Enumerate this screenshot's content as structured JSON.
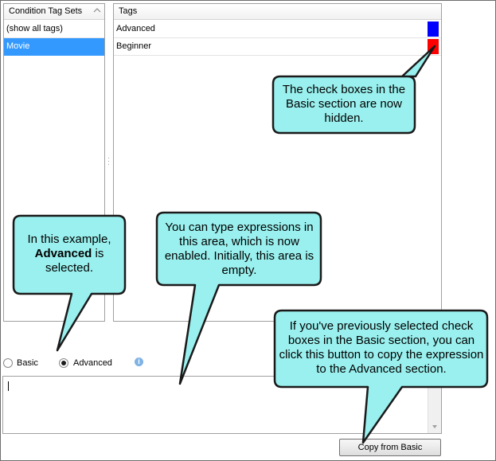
{
  "tag_sets_panel": {
    "header": "Condition Tag Sets",
    "items": [
      {
        "label": "(show all tags)",
        "selected": false
      },
      {
        "label": "Movie",
        "selected": true
      }
    ]
  },
  "tags_panel": {
    "header": "Tags",
    "items": [
      {
        "label": "Advanced",
        "color": "#0000ff"
      },
      {
        "label": "Beginner",
        "color": "#ff0000"
      }
    ]
  },
  "mode": {
    "basic_label": "Basic",
    "advanced_label": "Advanced",
    "selected": "Advanced"
  },
  "expression_area": {
    "value": ""
  },
  "copy_button_label": "Copy from Basic",
  "callouts": {
    "hidden_checkboxes": "The check boxes in the Basic section are now hidden.",
    "example_pre": "In this example,",
    "example_bold": "Advanced",
    "example_post": "is selected.",
    "type_expressions": "You can type expressions in this area, which is now enabled. Initially, this area is empty.",
    "copy_hint": "If you've previously selected check boxes in the Basic section, you can click this button to copy the expression to the Advanced section."
  },
  "colors": {
    "selection": "#3399ff",
    "callout_fill": "#99f0ee",
    "callout_stroke": "#1a1a1a"
  },
  "icons": [
    "sort-up-icon",
    "info-icon",
    "splitter-grip-icon"
  ]
}
